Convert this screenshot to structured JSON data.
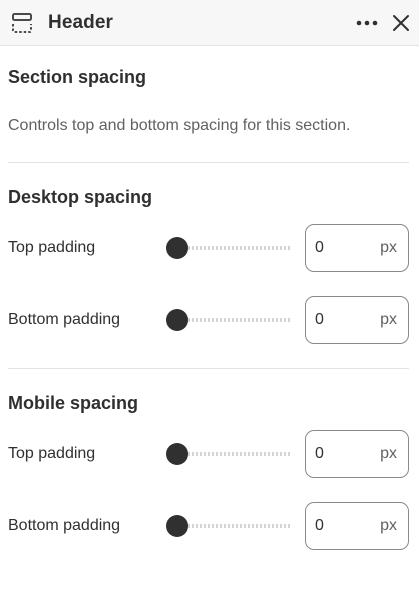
{
  "header": {
    "title": "Header",
    "section_icon": "section-layout-icon",
    "more_icon": "more-horizontal-icon",
    "close_icon": "close-icon"
  },
  "section": {
    "title": "Section spacing",
    "description": "Controls top and bottom spacing for this section."
  },
  "desktop": {
    "title": "Desktop spacing",
    "top": {
      "label": "Top padding",
      "value": "0",
      "unit": "px",
      "slider_fraction": 0
    },
    "bottom": {
      "label": "Bottom padding",
      "value": "0",
      "unit": "px",
      "slider_fraction": 0
    }
  },
  "mobile": {
    "title": "Mobile spacing",
    "top": {
      "label": "Top padding",
      "value": "0",
      "unit": "px",
      "slider_fraction": 0
    },
    "bottom": {
      "label": "Bottom padding",
      "value": "0",
      "unit": "px",
      "slider_fraction": 0
    }
  },
  "colors": {
    "text": "#303030",
    "muted": "#616161",
    "thumb": "#303030",
    "border": "#8a8a8a"
  }
}
